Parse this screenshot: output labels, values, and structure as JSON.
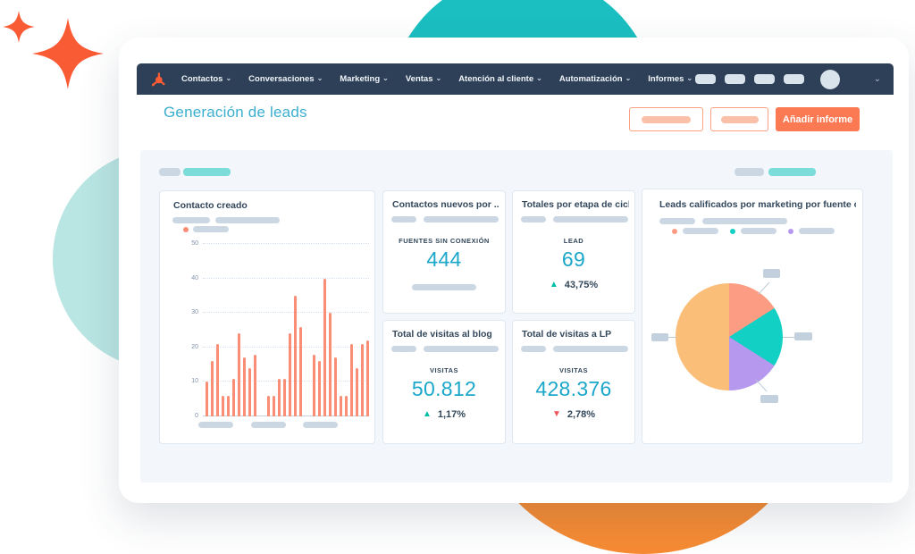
{
  "navbar": {
    "logo": "hubspot-sprocket",
    "items": [
      {
        "label": "Contactos"
      },
      {
        "label": "Conversaciones"
      },
      {
        "label": "Marketing"
      },
      {
        "label": "Ventas"
      },
      {
        "label": "Atención al cliente"
      },
      {
        "label": "Automatización"
      },
      {
        "label": "Informes"
      }
    ]
  },
  "icons": {
    "chevron_down": "⌄",
    "up_triangle": "▲",
    "down_triangle": "▼"
  },
  "header": {
    "title": "Generación de leads",
    "add_report_label": "Añadir informe"
  },
  "cards": {
    "contact_created": {
      "title": "Contacto creado"
    },
    "new_contacts": {
      "title": "Contactos nuevos por ...",
      "metric_label": "FUENTES SIN CONEXIÓN",
      "value": "444"
    },
    "lifecycle": {
      "title": "Totales por etapa de ciclo...",
      "metric_label": "LEAD",
      "value": "69",
      "delta": "43,75%",
      "delta_direction": "up"
    },
    "blog_visits": {
      "title": "Total de visitas al blog",
      "metric_label": "VISITAS",
      "value": "50.812",
      "delta": "1,17%",
      "delta_direction": "up"
    },
    "lp_visits": {
      "title": "Total de visitas a LP",
      "metric_label": "VISITAS",
      "value": "428.376",
      "delta": "2,78%",
      "delta_direction": "down"
    },
    "mql_by_source": {
      "title": "Leads calificados por marketing por fuente original"
    }
  },
  "chart_data": [
    {
      "type": "bar",
      "title": "Contacto creado",
      "groups": [
        [
          10,
          16,
          21,
          6,
          6,
          11,
          24,
          17,
          14,
          18
        ],
        [
          6,
          6,
          11,
          11,
          24,
          35,
          26
        ],
        [
          18,
          16,
          40,
          30,
          17,
          6,
          6,
          21,
          14,
          21,
          22
        ]
      ],
      "yticks": [
        0,
        10,
        20,
        30,
        40,
        50
      ],
      "ylim": [
        0,
        50
      ],
      "bar_color": "#F98D75",
      "grid": "dotted horizontal",
      "legend": "single coral series (placeholder label)"
    },
    {
      "type": "pie",
      "title": "Leads calificados por marketing por fuente original",
      "slices": [
        {
          "name": "slice-coral",
          "value": 16,
          "color": "#FB9C83"
        },
        {
          "name": "slice-teal",
          "value": 18,
          "color": "#12D0C3"
        },
        {
          "name": "slice-purple",
          "value": 16,
          "color": "#B698EE"
        },
        {
          "name": "slice-peach",
          "value": 50,
          "color": "#FBBE79"
        }
      ],
      "legend_position": "top",
      "callouts": 4
    }
  ],
  "colors": {
    "navbar_bg": "#2E4057",
    "accent_orange": "#FF5C35",
    "button_solid": "#FB7A53",
    "title_cyan": "#3BAFCE",
    "value_teal": "#1BA7C9",
    "positive": "#00BDA5",
    "negative": "#F2545B",
    "circle_top": "#1BBFC1",
    "circle_left": "#B9E5E3",
    "circle_bottom": "#F68B33"
  }
}
